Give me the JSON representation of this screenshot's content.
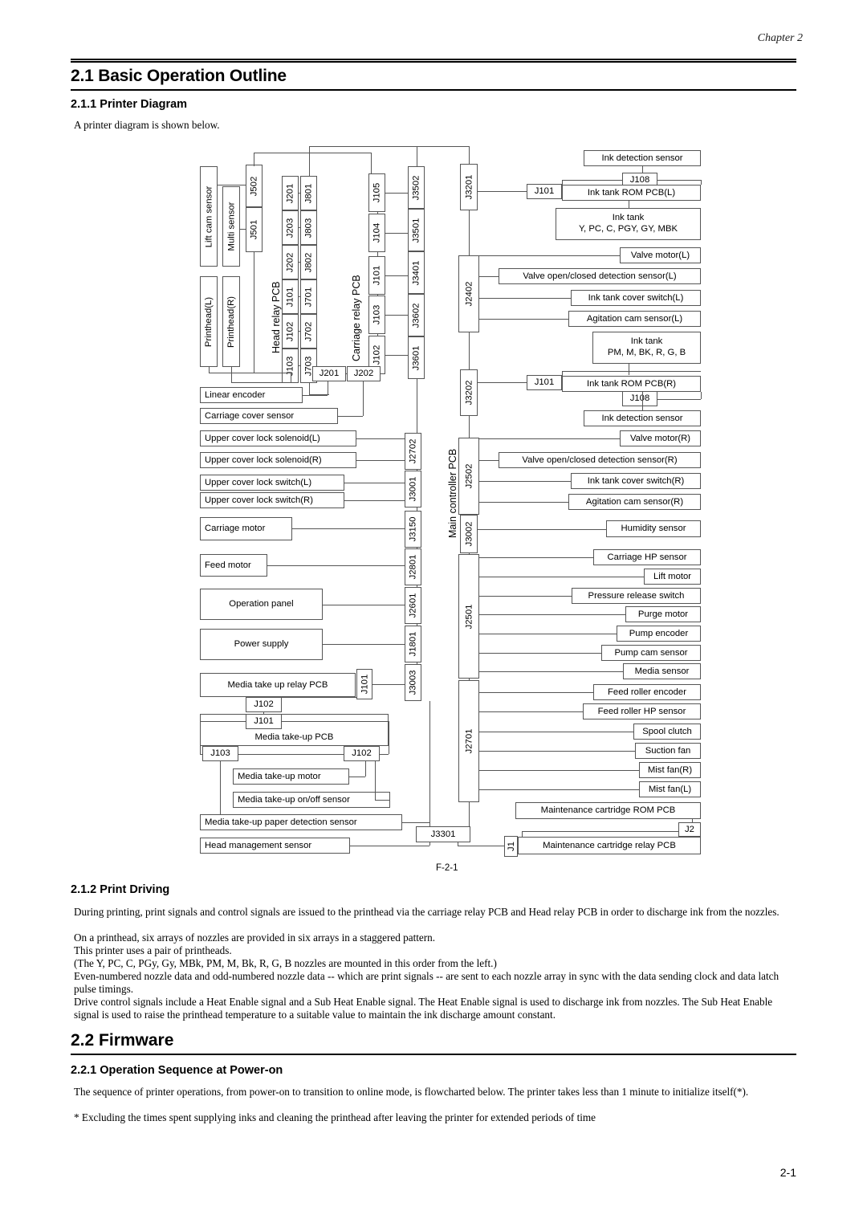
{
  "header": {
    "chapter": "Chapter 2"
  },
  "sections": {
    "h1_basic": "2.1 Basic Operation Outline",
    "h2_printer_diagram": "2.1.1 Printer Diagram",
    "intro": "A printer diagram is shown below.",
    "figure_label": "F-2-1",
    "h2_print_driving": "2.1.2 Print Driving",
    "print_driving_paragraphs": [
      "During printing, print signals and control signals are issued to the printhead via the carriage relay PCB and Head relay PCB in order to discharge ink from the nozzles.",
      "On a printhead, six arrays of nozzles are provided in six arrays in a staggered pattern.",
      "This printer uses a pair of printheads.",
      "(The Y, PC, C, PGy, Gy, MBk, PM, M, Bk, R, G, B nozzles are mounted in this order from the left.)",
      "Even-numbered nozzle data and odd-numbered nozzle data -- which are print signals -- are sent to each nozzle array in sync with the data sending clock and data latch pulse timings.",
      "Drive control signals include a Heat Enable signal and a Sub Heat Enable signal. The Heat Enable signal is used to discharge ink from nozzles. The Sub Heat Enable signal is used to raise the printhead temperature to a suitable value to maintain the ink discharge amount constant."
    ],
    "h1_firmware": "2.2 Firmware",
    "h2_power_on": "2.2.1 Operation Sequence at Power-on",
    "power_on_paragraph": "The sequence of printer operations, from power-on to transition to online mode, is flowcharted below. The printer takes less than 1 minute to initialize itself(*).",
    "power_on_footnote": "* Excluding the times spent supplying inks and cleaning the printhead after leaving the printer for extended periods of time"
  },
  "footer": {
    "page_number": "2-1"
  },
  "diagram": {
    "pcb_titles": {
      "head_relay": "Head relay PCB",
      "carriage_relay": "Carriage relay PCB",
      "main_controller": "Main controller PCB"
    },
    "left_devices": {
      "lift_cam_sensor": "Lift cam sensor",
      "multi_sensor": "Multi sensor",
      "printhead_l": "Printhead(L)",
      "printhead_r": "Printhead(R)"
    },
    "head_relay_connectors_col1": [
      "J502",
      "J501"
    ],
    "head_relay_connectors_col2": [
      "J201",
      "J203",
      "J202",
      "J101",
      "J102",
      "J103"
    ],
    "head_relay_connectors_col3": [
      "J801",
      "J803",
      "J802",
      "J701",
      "J702",
      "J703"
    ],
    "carriage_relay_connectors": [
      "J105",
      "J104",
      "J101",
      "J103",
      "J102"
    ],
    "carriage_main_connectors": [
      "J3502",
      "J3501",
      "J3401",
      "J3602",
      "J3601"
    ],
    "carriage_bottom_connectors": [
      "J201",
      "J202"
    ],
    "left_column_devices": [
      "Linear encoder",
      "Carriage cover sensor",
      "Upper cover lock solenoid(L)",
      "Upper cover lock solenoid(R)",
      "Upper cover lock switch(L)",
      "Upper cover lock switch(R)",
      "Carriage motor",
      "Feed motor",
      "Operation panel",
      "Power supply"
    ],
    "main_left_connectors": [
      "J2702",
      "J3001",
      "J3150",
      "J2801",
      "J2601",
      "J1801",
      "J3003"
    ],
    "media_takeup": {
      "relay_pcb": "Media take up relay PCB",
      "relay_pcb_j101": "J101",
      "relay_pcb_j102": "J102",
      "pcb_j101": "J101",
      "pcb": "Media take-up PCB",
      "pcb_j103": "J103",
      "pcb_j102": "J102",
      "motor": "Media take-up motor",
      "on_off_sensor": "Media take-up on/off sensor",
      "paper_detection_sensor": "Media take-up paper detection sensor"
    },
    "head_management_sensor": "Head management sensor",
    "main_bottom_connector": "J3301",
    "main_right_connectors": [
      "J3201",
      "J2402",
      "J3202",
      "J2502",
      "J3002",
      "J2501",
      "J2701"
    ],
    "ink_left": {
      "detection_sensor": "Ink detection sensor",
      "j108": "J108",
      "j101": "J101",
      "rom_pcb": "Ink tank ROM PCB(L)",
      "tank_line1": "Ink tank",
      "tank_line2": "Y, PC, C, PGY, GY, MBK",
      "devices": [
        "Valve motor(L)",
        "Valve open/closed detection sensor(L)",
        "Ink tank cover switch(L)",
        "Agitation cam sensor(L)"
      ]
    },
    "ink_right": {
      "tank_line1": "Ink tank",
      "tank_line2": "PM, M, BK, R, G, B",
      "j101": "J101",
      "rom_pcb": "Ink tank ROM PCB(R)",
      "j108": "J108",
      "detection_sensor": "Ink detection sensor",
      "devices": [
        "Valve motor(R)",
        "Valve open/closed detection sensor(R)",
        "Ink tank cover switch(R)",
        "Agitation cam sensor(R)"
      ]
    },
    "humidity_sensor": "Humidity sensor",
    "j2501_devices": [
      "Carriage HP sensor",
      "Lift motor",
      "Pressure release switch",
      "Purge motor",
      "Pump encoder",
      "Pump cam sensor",
      "Media sensor"
    ],
    "j2701_devices": [
      "Feed roller encoder",
      "Feed roller HP sensor",
      "Spool clutch",
      "Suction fan",
      "Mist fan(R)",
      "Mist fan(L)"
    ],
    "maintenance": {
      "rom_pcb": "Maintenance cartridge ROM PCB",
      "relay_pcb": "Maintenance cartridge relay PCB",
      "j2": "J2",
      "j1": "J1"
    }
  }
}
